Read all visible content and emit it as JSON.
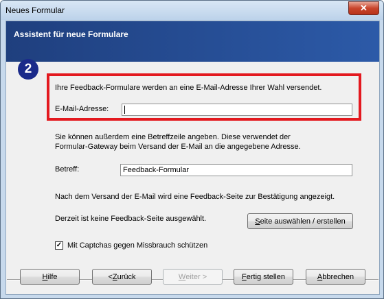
{
  "window": {
    "title": "Neues Formular",
    "close_symbol": "✕"
  },
  "banner": {
    "title": "Assistent für neue Formulare"
  },
  "step": {
    "number": "2"
  },
  "email": {
    "intro": "Ihre Feedback-Formulare werden an eine E-Mail-Adresse Ihrer Wahl versendet.",
    "label": "E-Mail-Adresse:",
    "value": ""
  },
  "subject": {
    "info_line1": "Sie können außerdem eine Betreffzeile angeben. Diese verwendet der",
    "info_line2": "Formular-Gateway beim Versand der E-Mail an die angegebene Adresse.",
    "label": "Betreff:",
    "value": "Feedback-Formular"
  },
  "feedback_page": {
    "info": "Nach dem Versand der E-Mail wird eine Feedback-Seite zur Bestätigung angezeigt.",
    "status": "Derzeit ist keine Feedback-Seite ausgewählt.",
    "button_label": "Seite auswählen / erstellen"
  },
  "captcha": {
    "label": "Mit Captchas gegen Missbrauch schützen",
    "checked": true,
    "check_mark": "✓"
  },
  "buttons": {
    "help": "Hilfe",
    "back": "< Zurück",
    "next": "Weiter >",
    "finish": "Fertig stellen",
    "cancel": "Abbrechen"
  },
  "colors": {
    "banner": "#1f3f7e",
    "highlight": "#e3191f",
    "badge": "#1a2a8a"
  }
}
